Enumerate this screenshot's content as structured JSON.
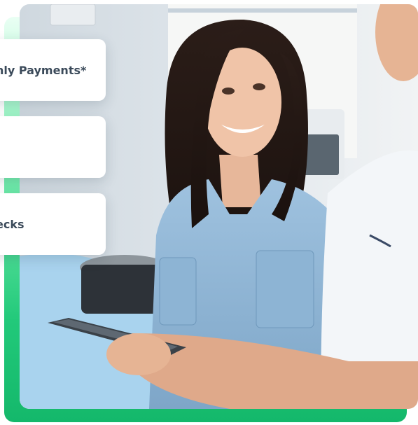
{
  "cards": [
    {
      "text": "nly Payments*"
    },
    {
      "text": ""
    },
    {
      "text": "ecks"
    }
  ],
  "colors": {
    "accent_green": "#22c97a",
    "card_text": "#3b4a5a",
    "card_bg": "#ffffff"
  },
  "photo": {
    "subject": "dental-consultation-photo"
  }
}
